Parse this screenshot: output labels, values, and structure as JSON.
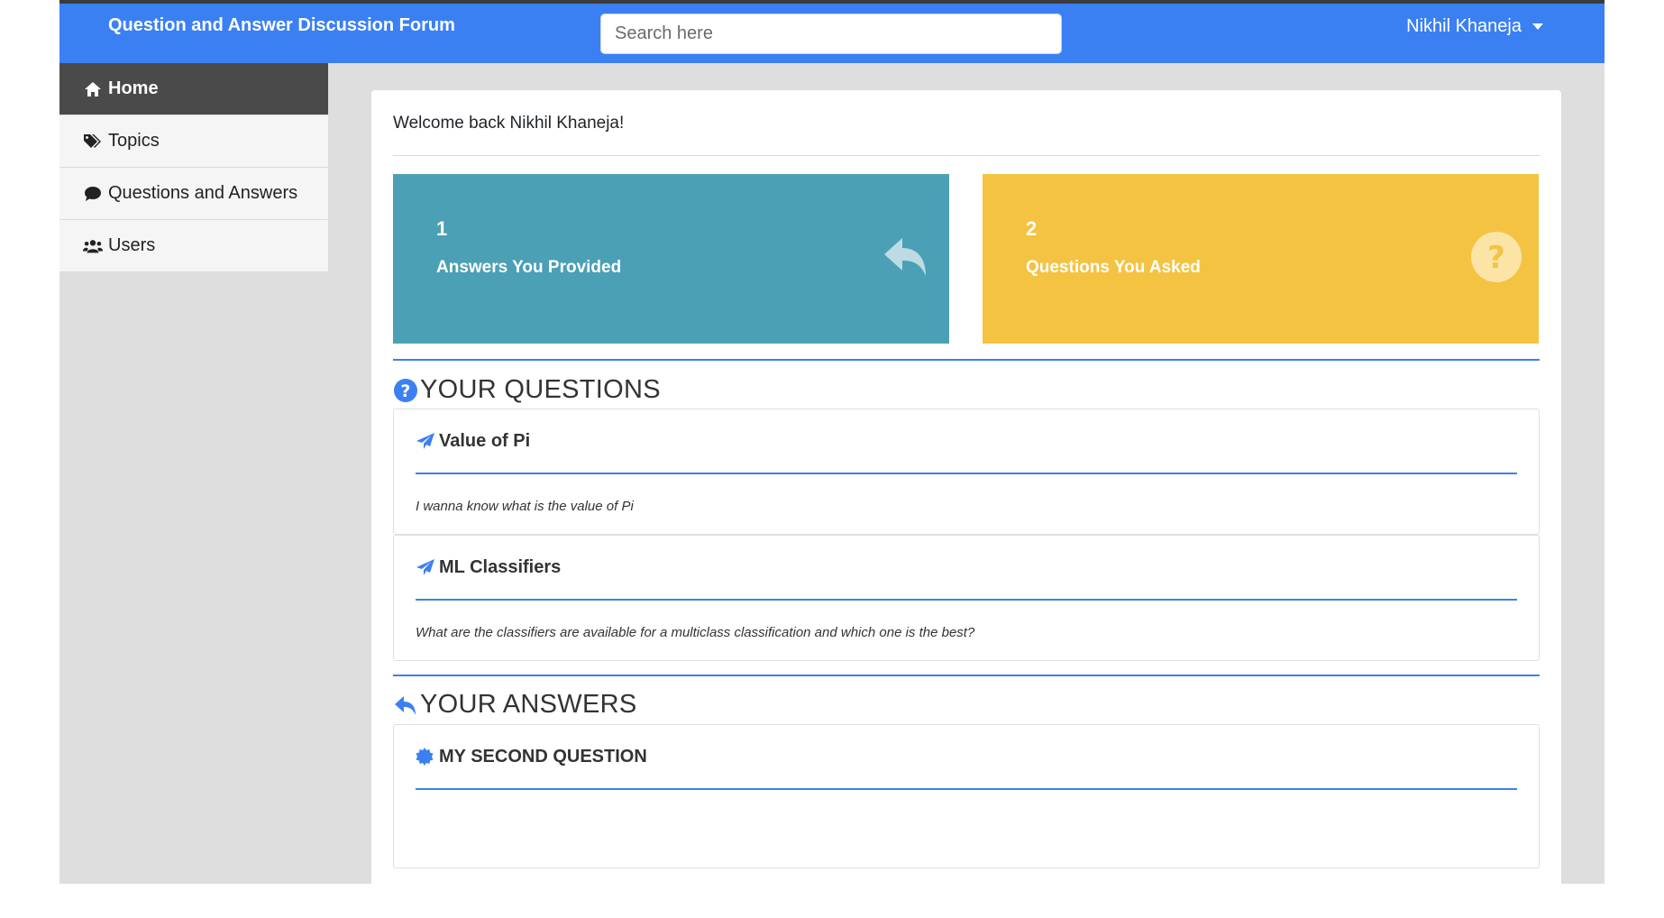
{
  "navbar": {
    "brand": "Question and Answer Discussion Forum",
    "search_placeholder": "Search here",
    "user_name": "Nikhil Khaneja"
  },
  "sidebar": {
    "items": [
      {
        "label": "Home",
        "icon": "home-icon",
        "active": true
      },
      {
        "label": "Topics",
        "icon": "tags-icon",
        "active": false
      },
      {
        "label": "Questions and Answers",
        "icon": "comment-icon",
        "active": false
      },
      {
        "label": "Users",
        "icon": "users-icon",
        "active": false
      }
    ]
  },
  "main": {
    "welcome": "Welcome back Nikhil Khaneja!",
    "stats": [
      {
        "count": "1",
        "label": "Answers You Provided",
        "icon": "reply-icon",
        "color": "#4ba0b5"
      },
      {
        "count": "2",
        "label": "Questions You Asked",
        "icon": "question-circle-icon",
        "color": "#f4c342"
      }
    ],
    "questions_title": "YOUR QUESTIONS",
    "questions": [
      {
        "title": "Value of Pi",
        "body": "I wanna know what is the value of Pi"
      },
      {
        "title": "ML Classifiers",
        "body": "What are the classifiers are available for a multiclass classification and which one is the best?"
      }
    ],
    "answers_title": "YOUR ANSWERS",
    "answers": [
      {
        "title": "MY SECOND QUESTION"
      }
    ]
  },
  "colors": {
    "accent": "#3b80f3",
    "sidebar_active": "#4a4a4a",
    "page_bg": "#dedede"
  }
}
